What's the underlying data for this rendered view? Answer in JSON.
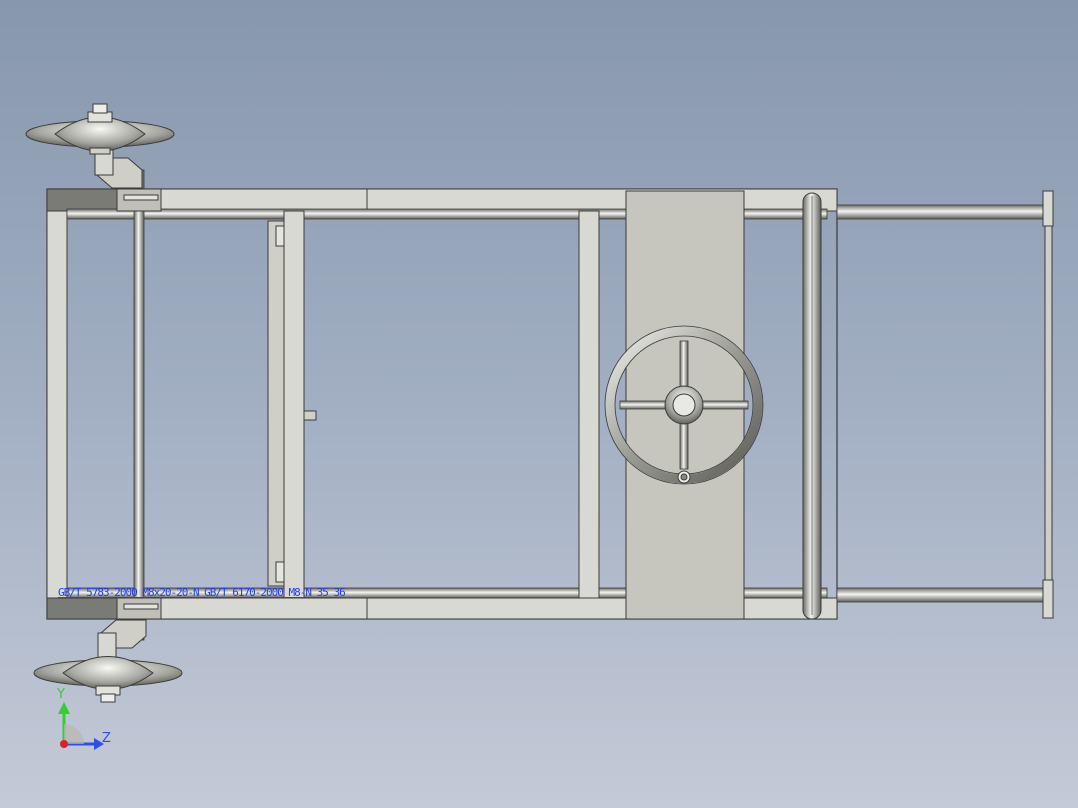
{
  "viewport": {
    "background_top": "#8797ad",
    "background_bottom": "#c4cad7"
  },
  "model": {
    "frame_color": "#d9d9d3",
    "frame_outline": "#3a3a3a",
    "panel_color": "#c5c5bd",
    "metal_highlight": "#f2f2ee",
    "metal_shadow": "#6a6a66"
  },
  "annotation": {
    "text": "GB/T 5783-2000 M8x20-20-N GB/T 6170-2000 M8-N 35 36"
  },
  "triad": {
    "y_label": "Y",
    "z_label": "Z",
    "y_color": "#2fd12f",
    "z_color": "#2d4fe6",
    "x_color": "#e02020"
  }
}
